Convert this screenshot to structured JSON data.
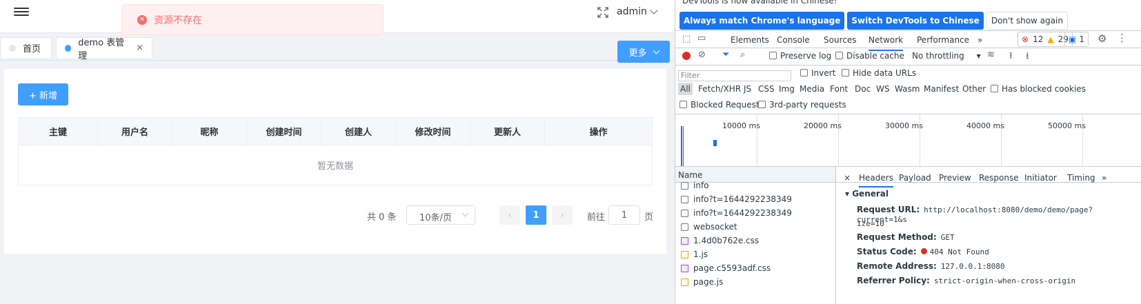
{
  "topbar": {
    "user": "admin"
  },
  "message": {
    "text": "资源不存在"
  },
  "tabs": [
    {
      "label": "首页"
    },
    {
      "label": "demo 表管理",
      "close": "×"
    }
  ],
  "more_button": "更多",
  "add_button": "+ 新增",
  "table": {
    "columns": [
      "主键",
      "用户名",
      "昵称",
      "创建时间",
      "创建人",
      "修改时间",
      "更新人",
      "操作"
    ],
    "empty_text": "暂无数据"
  },
  "pagination": {
    "total": "共 0 条",
    "page_size": "10条/页",
    "prev": "‹",
    "current": "1",
    "next": "›",
    "goto_label": "前往",
    "goto_value": "1",
    "page_suffix": "页"
  },
  "devtools": {
    "banner": "DevTools is now available in Chinese!",
    "lang_buttons": [
      "Always match Chrome's language",
      "Switch DevTools to Chinese",
      "Don't show again"
    ],
    "tabs": [
      "Elements",
      "Console",
      "Sources",
      "Network",
      "Performance",
      "»"
    ],
    "errors": "12",
    "warnings": "29",
    "messages": "1",
    "toolbar": {
      "preserve_log": "Preserve log",
      "disable_cache": "Disable cache",
      "throttling": "No throttling"
    },
    "filter_placeholder": "Filter",
    "invert": "Invert",
    "hide_data_urls": "Hide data URLs",
    "types": [
      "All",
      "Fetch/XHR",
      "JS",
      "CSS",
      "Img",
      "Media",
      "Font",
      "Doc",
      "WS",
      "Wasm",
      "Manifest",
      "Other"
    ],
    "has_blocked_cookies": "Has blocked cookies",
    "blocked_requests": "Blocked Requests",
    "third_party": "3rd-party requests",
    "timeline_labels": [
      "10000 ms",
      "20000 ms",
      "30000 ms",
      "40000 ms",
      "50000 ms"
    ],
    "name_header": "Name",
    "requests": [
      {
        "name": "info",
        "type": "doc"
      },
      {
        "name": "info?t=1644292238349",
        "type": "doc"
      },
      {
        "name": "info?t=1644292238349",
        "type": "doc"
      },
      {
        "name": "websocket",
        "type": "doc"
      },
      {
        "name": "1.4d0b762e.css",
        "type": "css"
      },
      {
        "name": "1.js",
        "type": "js"
      },
      {
        "name": "page.c5593adf.css",
        "type": "css"
      },
      {
        "name": "page.js",
        "type": "js"
      }
    ],
    "detail_tabs": [
      "×",
      "Headers",
      "Payload",
      "Preview",
      "Response",
      "Initiator",
      "Timing",
      "»"
    ],
    "general_title": "General",
    "general": [
      {
        "key": "Request URL:",
        "value": "http://localhost:8080/demo/demo/page?current=1&s"
      },
      {
        "key": "",
        "value": "ize=10"
      },
      {
        "key": "Request Method:",
        "value": "GET"
      },
      {
        "key": "Status Code:",
        "value": "404 Not Found"
      },
      {
        "key": "Remote Address:",
        "value": "127.0.0.1:8080"
      },
      {
        "key": "Referrer Policy:",
        "value": "strict-origin-when-cross-origin"
      }
    ],
    "colors": {
      "accent": "#1a73e8",
      "error": "#d93025",
      "warning": "#f9ab00",
      "css": "#a142f4",
      "js": "#e8a317"
    }
  }
}
